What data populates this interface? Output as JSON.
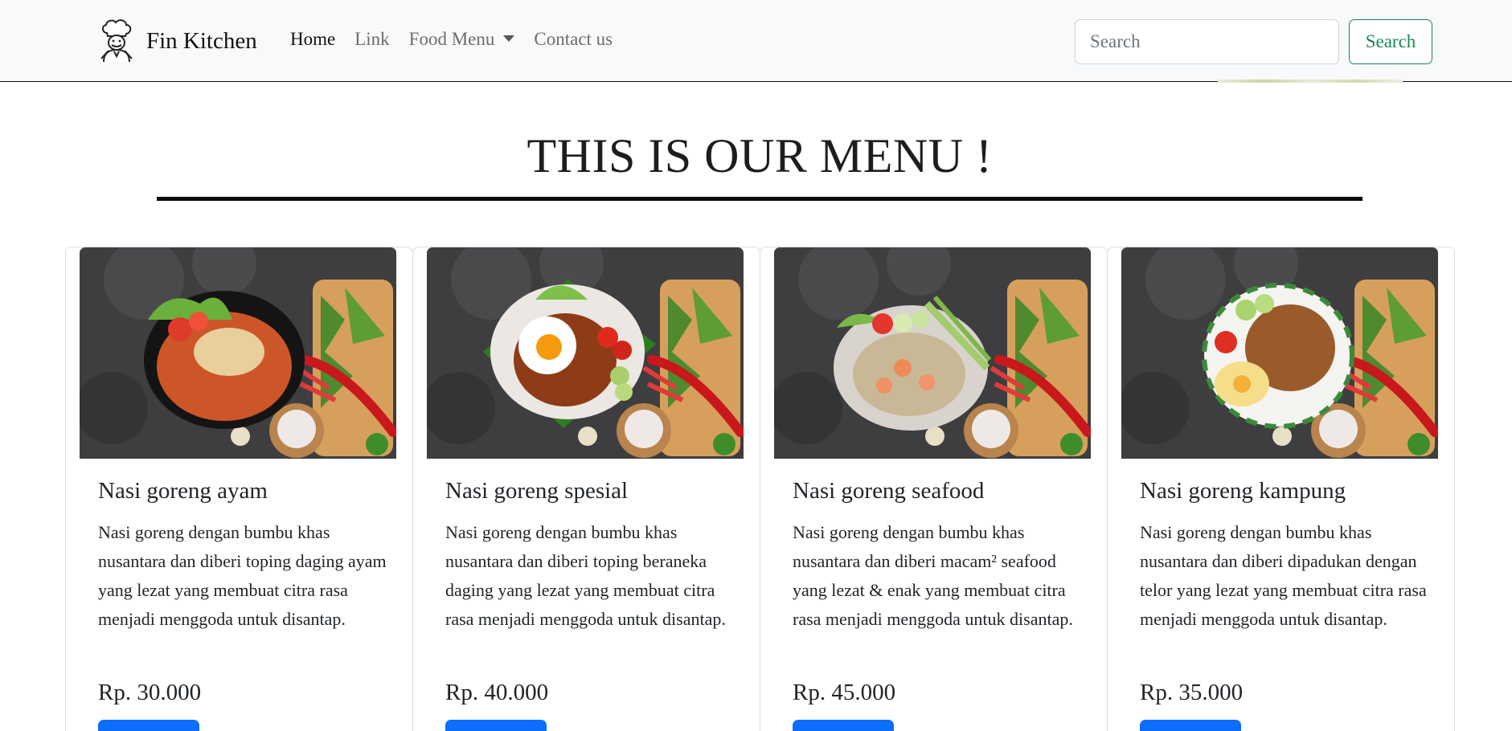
{
  "navbar": {
    "brand": "Fin Kitchen",
    "links": [
      {
        "label": "Home",
        "active": true
      },
      {
        "label": "Link"
      },
      {
        "label": "Food Menu",
        "dropdown": true
      },
      {
        "label": "Contact us"
      }
    ],
    "search": {
      "placeholder": "Search",
      "value": "",
      "button_label": "Search"
    }
  },
  "page": {
    "title": "THIS IS OUR MENU !"
  },
  "menu": [
    {
      "title": "Nasi goreng ayam",
      "description": "Nasi goreng dengan bumbu khas nusantara dan diberi toping daging ayam yang lezat yang membuat citra rasa menjadi menggoda untuk disantap.",
      "price": "Rp. 30.000",
      "button_label": ""
    },
    {
      "title": "Nasi goreng spesial",
      "description": "Nasi goreng dengan bumbu khas nusantara dan diberi toping beraneka daging yang lezat yang membuat citra rasa menjadi menggoda untuk disantap.",
      "price": "Rp. 40.000",
      "button_label": ""
    },
    {
      "title": "Nasi goreng seafood",
      "description": "Nasi goreng dengan bumbu khas nusantara dan diberi macam² seafood yang lezat & enak yang membuat citra rasa menjadi menggoda untuk disantap.",
      "price": "Rp. 45.000",
      "button_label": ""
    },
    {
      "title": "Nasi goreng kampung",
      "description": "Nasi goreng dengan bumbu khas nusantara dan diberi dipadukan dengan telor yang lezat yang membuat citra rasa menjadi menggoda untuk disantap.",
      "price": "Rp. 35.000",
      "button_label": ""
    }
  ],
  "colors": {
    "primary": "#0d6efd",
    "success": "#198754",
    "navbar_bg": "#f8f9fa"
  },
  "icons": {
    "brand_logo": "chef-icon",
    "dropdown": "caret-down-icon"
  }
}
